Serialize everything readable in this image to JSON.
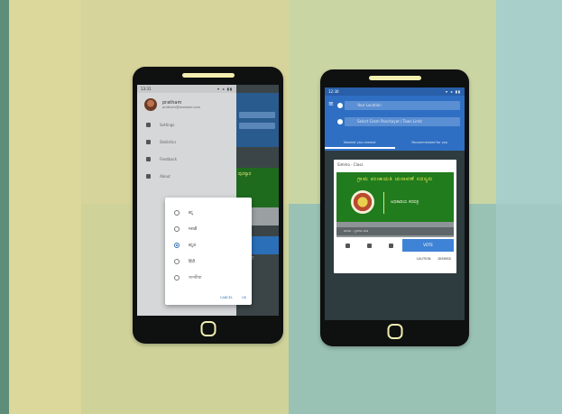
{
  "phone_left": {
    "drawer": {
      "profile_name": "pratham",
      "profile_email": "pratham@example.com",
      "items": [
        {
          "label": "Settings"
        },
        {
          "label": "Statistics"
        },
        {
          "label": "Feedback"
        },
        {
          "label": "About"
        }
      ]
    },
    "language_dialog": {
      "options": [
        {
          "label": "ಕನ್ನ",
          "checked": false
        },
        {
          "label": "मराठी",
          "checked": false
        },
        {
          "label": "ಕನ್ನಡ",
          "checked": true
        },
        {
          "label": "हिंदी",
          "checked": false
        },
        {
          "label": "অসমীয়া",
          "checked": false
        }
      ],
      "cancel_label": "CANCEL",
      "ok_label": "OK"
    },
    "background_app": {
      "green_text": "ಪುರಸ್ಕಾರ",
      "grey_label": "SUBMIT"
    }
  },
  "phone_right": {
    "statusbar_time": "12:30",
    "fields": [
      {
        "placeholder": "Your Location"
      },
      {
        "placeholder": "Select Gram Panchayat / Town Limit"
      }
    ],
    "tabs": [
      {
        "label": "Nearest you nearest",
        "active": true
      },
      {
        "label": "Recommended for you",
        "active": false
      }
    ],
    "card": {
      "title": "Simmo - Class",
      "banner_title": "ಗ್ರಾಮ ಪಂಚಾಯತಿ ಚುನಾವಣೆ ಸದಸ್ಯರು",
      "banner_sub": "ಅಧಿಕಾರಿಯ ಕರಪತ್ರ",
      "strip_text": "ವಲಯ - ಸ್ಥಳೀಯ ಮತ",
      "button_label": "VOTE",
      "actions": [
        "CAUTION",
        "DISMISS"
      ]
    }
  }
}
